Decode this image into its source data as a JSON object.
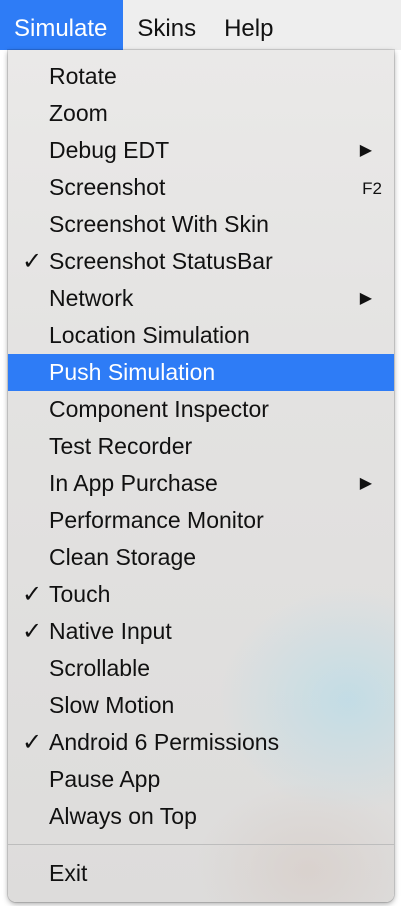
{
  "menubar": {
    "items": [
      {
        "label": "Simulate"
      },
      {
        "label": "Skins"
      },
      {
        "label": "Help"
      }
    ]
  },
  "menu": {
    "items": [
      {
        "label": "Rotate"
      },
      {
        "label": "Zoom"
      },
      {
        "label": "Debug EDT",
        "submenu": true
      },
      {
        "label": "Screenshot",
        "shortcut": "F2"
      },
      {
        "label": "Screenshot With Skin"
      },
      {
        "label": "Screenshot StatusBar",
        "checked": true,
        "check": "✓"
      },
      {
        "label": "Network",
        "submenu": true
      },
      {
        "label": "Location Simulation"
      },
      {
        "label": "Push Simulation",
        "highlighted": true
      },
      {
        "label": "Component Inspector"
      },
      {
        "label": "Test Recorder"
      },
      {
        "label": "In App Purchase",
        "submenu": true
      },
      {
        "label": "Performance Monitor"
      },
      {
        "label": "Clean Storage"
      },
      {
        "label": "Touch",
        "checked": true,
        "check": "✓"
      },
      {
        "label": "Native Input",
        "checked": true,
        "check": "✓"
      },
      {
        "label": "Scrollable"
      },
      {
        "label": "Slow Motion"
      },
      {
        "label": "Android 6 Permissions",
        "checked": true,
        "check": "✓"
      },
      {
        "label": "Pause App"
      },
      {
        "label": "Always on Top"
      }
    ],
    "exit": {
      "label": "Exit"
    },
    "submenu_arrow": "▶"
  },
  "colors": {
    "highlight": "#2e7cf6",
    "menubar_bg": "#eeeeee",
    "text": "#111111"
  }
}
